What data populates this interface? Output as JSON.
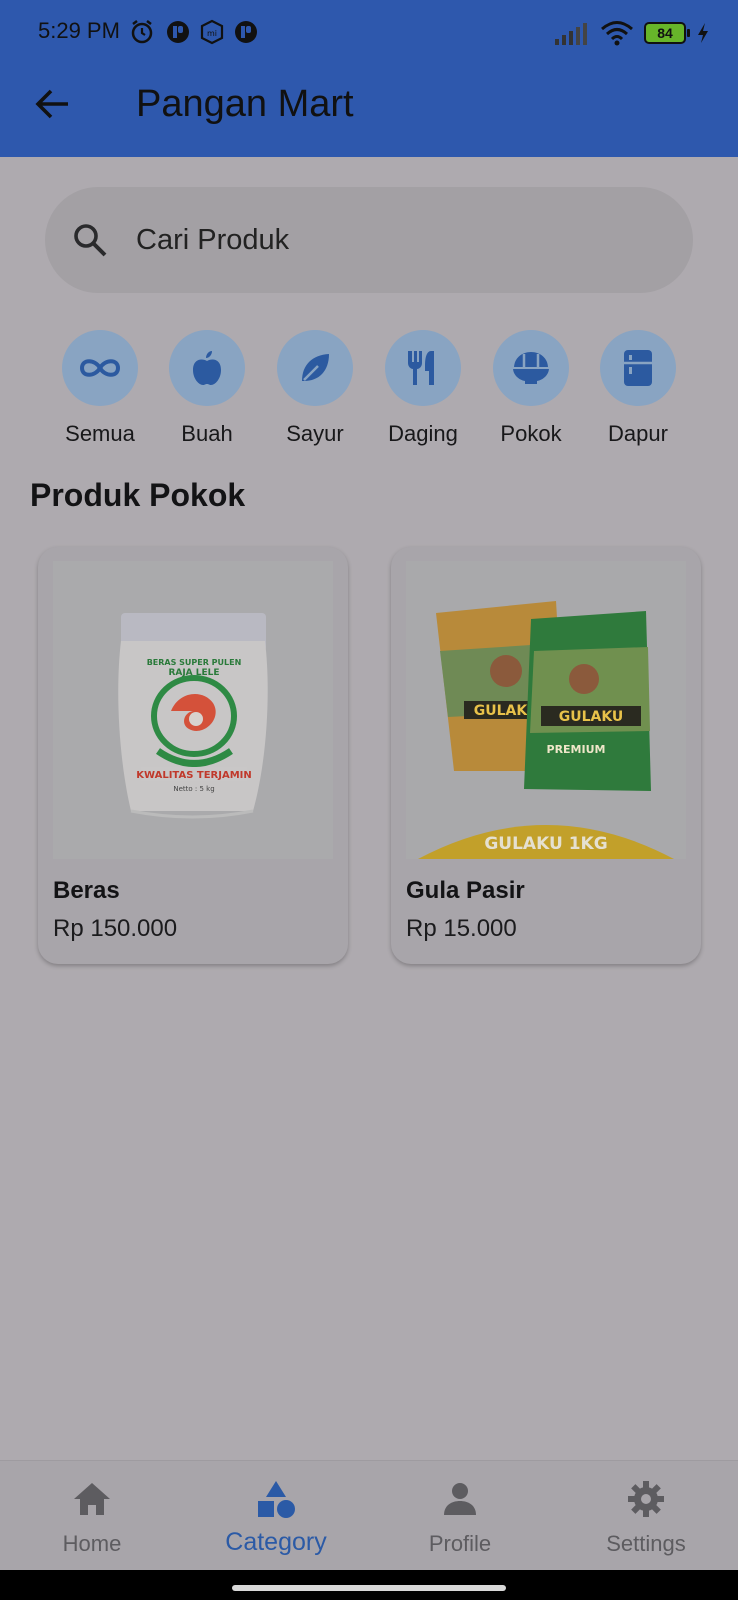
{
  "status_bar": {
    "time": "5:29 PM",
    "battery": "84"
  },
  "app_bar": {
    "title": "Pangan Mart"
  },
  "search": {
    "placeholder": "Cari Produk"
  },
  "categories": [
    {
      "label": "Semua",
      "icon": "infinity-icon"
    },
    {
      "label": "Buah",
      "icon": "apple-icon"
    },
    {
      "label": "Sayur",
      "icon": "leaf-icon"
    },
    {
      "label": "Daging",
      "icon": "fork-knife-icon"
    },
    {
      "label": "Pokok",
      "icon": "rice-bowl-icon"
    },
    {
      "label": "Dapur",
      "icon": "fridge-icon"
    }
  ],
  "section_title": "Produk Pokok",
  "products": [
    {
      "name": "Beras",
      "price": "Rp 150.000",
      "image_text": [
        "BERAS SUPER PULEN",
        "RAJA LELE",
        "KWALITAS TERJAMIN",
        "Netto : 5 kg"
      ]
    },
    {
      "name": "Gula Pasir",
      "price": "Rp 15.000",
      "image_text": [
        "GULAKU",
        "PREMIUM",
        "GULAKU 1KG"
      ]
    }
  ],
  "bottom_nav": [
    {
      "label": "Home",
      "icon": "home-icon",
      "active": false
    },
    {
      "label": "Category",
      "icon": "category-icon",
      "active": true
    },
    {
      "label": "Profile",
      "icon": "person-icon",
      "active": false
    },
    {
      "label": "Settings",
      "icon": "gear-icon",
      "active": false
    }
  ],
  "colors": {
    "app_bar": "#2e58ad",
    "accent": "#2b5aa6",
    "category_circle": "#89a4c2",
    "scrim_background": "#aeaaaf"
  }
}
